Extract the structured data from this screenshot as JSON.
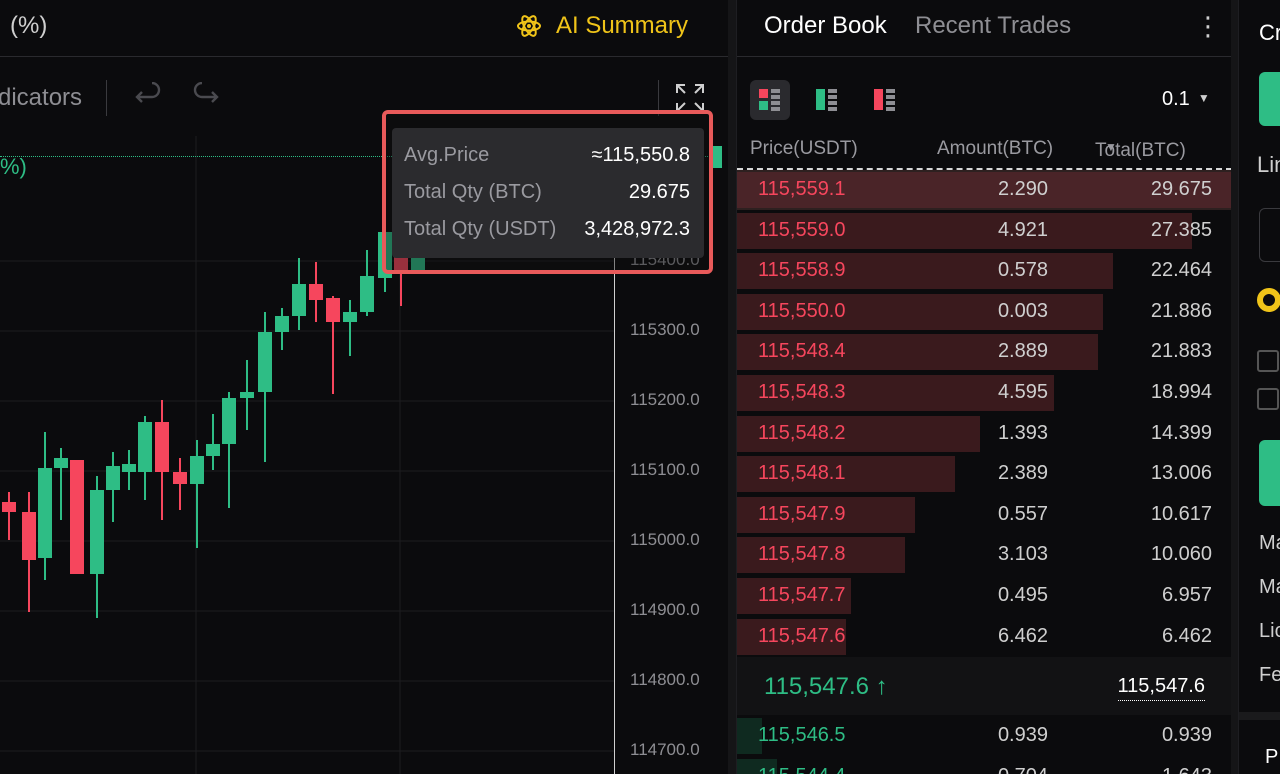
{
  "chart_header": {
    "pct_title": "(%)",
    "ai_summary_label": "AI Summary",
    "ai_icon": "atom-icon",
    "accent_color": "#f0c419"
  },
  "toolbar": {
    "indicators_label": "dicators",
    "undo_icon": "undo-icon",
    "redo_icon": "redo-icon",
    "expand_icon": "fullscreen-icon"
  },
  "chart": {
    "pct_label": "%)",
    "price_axis": [
      "115400.0",
      "115300.0",
      "115200.0",
      "115100.0",
      "115000.0",
      "114900.0",
      "114800.0",
      "114700.0"
    ],
    "up_color": "#2ebd85",
    "down_color": "#f6465d"
  },
  "tooltip": {
    "rows": [
      {
        "label": "Avg.Price",
        "value": "≈115,550.8"
      },
      {
        "label": "Total Qty (BTC)",
        "value": "29.675"
      },
      {
        "label": "Total Qty (USDT)",
        "value": "3,428,972.3"
      }
    ]
  },
  "orderbook": {
    "tabs": [
      "Order Book",
      "Recent Trades"
    ],
    "more_icon": "more-vertical-icon",
    "precision": "0.1",
    "columns": [
      "Price(USDT)",
      "Amount(BTC)",
      "Total(BTC)"
    ],
    "asks": [
      {
        "price": "115,559.1",
        "amount": "2.290",
        "total": "29.675",
        "depth": 1.0
      },
      {
        "price": "115,559.0",
        "amount": "4.921",
        "total": "27.385",
        "depth": 0.92
      },
      {
        "price": "115,558.9",
        "amount": "0.578",
        "total": "22.464",
        "depth": 0.76
      },
      {
        "price": "115,550.0",
        "amount": "0.003",
        "total": "21.886",
        "depth": 0.74
      },
      {
        "price": "115,548.4",
        "amount": "2.889",
        "total": "21.883",
        "depth": 0.73
      },
      {
        "price": "115,548.3",
        "amount": "4.595",
        "total": "18.994",
        "depth": 0.64
      },
      {
        "price": "115,548.2",
        "amount": "1.393",
        "total": "14.399",
        "depth": 0.49
      },
      {
        "price": "115,548.1",
        "amount": "2.389",
        "total": "13.006",
        "depth": 0.44
      },
      {
        "price": "115,547.9",
        "amount": "0.557",
        "total": "10.617",
        "depth": 0.36
      },
      {
        "price": "115,547.8",
        "amount": "3.103",
        "total": "10.060",
        "depth": 0.34
      },
      {
        "price": "115,547.7",
        "amount": "0.495",
        "total": "6.957",
        "depth": 0.23
      },
      {
        "price": "115,547.6",
        "amount": "6.462",
        "total": "6.462",
        "depth": 0.22
      }
    ],
    "last_price": "115,547.6",
    "last_arrow": "↑",
    "mark_price": "115,547.6",
    "bids": [
      {
        "price": "115,546.5",
        "amount": "0.939",
        "total": "0.939",
        "depth": 0.05
      },
      {
        "price": "115,544.4",
        "amount": "0.704",
        "total": "1.643",
        "depth": 0.08
      }
    ]
  },
  "trade_panel": {
    "title": "Cr",
    "order_type": "Lin",
    "labels": [
      "Ma",
      "Ma",
      "Lic",
      "Fe"
    ],
    "bottom_label": "P"
  }
}
